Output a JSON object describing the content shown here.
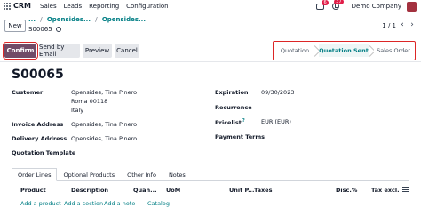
{
  "topbar": {
    "app_name": "CRM",
    "menu": [
      "Sales",
      "Leads",
      "Reporting",
      "Configuration"
    ],
    "chat_badge": "6",
    "activity_badge": "37",
    "company": "Demo Company"
  },
  "control": {
    "new_label": "New",
    "crumbs": [
      "...",
      "Opensides...",
      "Opensides..."
    ],
    "record_title": "S00065",
    "pager": "1 / 1"
  },
  "actions": {
    "confirm": "Confirm",
    "send_email": "Send by Email",
    "preview": "Preview",
    "cancel": "Cancel"
  },
  "status": {
    "stages": [
      "Quotation",
      "Quotation Sent",
      "Sales Order"
    ],
    "active": "Quotation Sent"
  },
  "form": {
    "doc_name": "S00065",
    "customer_label": "Customer",
    "customer_lines": [
      "Opensides, Tina Pinero",
      "Roma 00118",
      "Italy"
    ],
    "invoice_label": "Invoice Address",
    "invoice_value": "Opensides, Tina Pinero",
    "delivery_label": "Delivery Address",
    "delivery_value": "Opensides, Tina Pinero",
    "template_label": "Quotation Template",
    "expiration_label": "Expiration",
    "expiration_value": "09/30/2023",
    "recurrence_label": "Recurrence",
    "pricelist_label": "Pricelist",
    "pricelist_help": "?",
    "pricelist_value": "EUR (EUR)",
    "payment_terms_label": "Payment Terms"
  },
  "tabs": [
    "Order Lines",
    "Optional Products",
    "Other Info",
    "Notes"
  ],
  "lines": {
    "headers": [
      "Product",
      "Description",
      "Quan...",
      "UoM",
      "Unit P...",
      "Taxes",
      "Disc.%",
      "Tax excl."
    ],
    "add_product": "Add a product",
    "add_section": "Add a section",
    "add_note": "Add a note",
    "catalog": "Catalog"
  },
  "colors": {
    "brand": "#714b67",
    "link": "#017e84",
    "highlight": "#dc2626"
  }
}
